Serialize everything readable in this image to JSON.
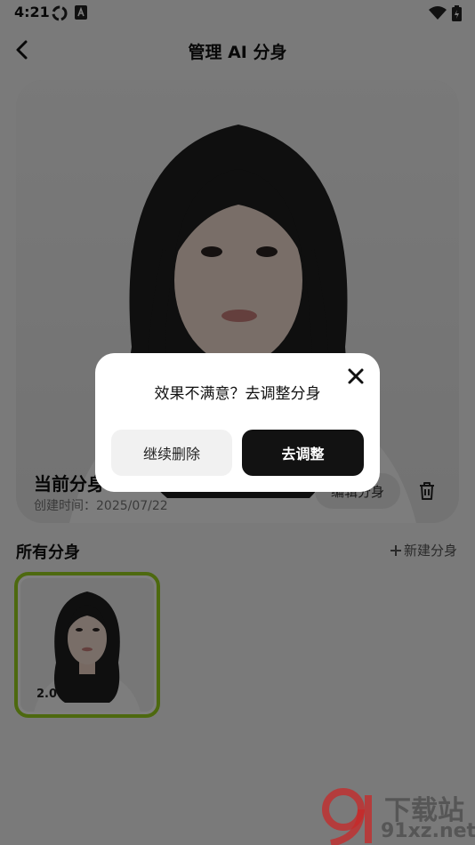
{
  "status": {
    "time": "4:21"
  },
  "appbar": {
    "title": "管理 AI 分身"
  },
  "current": {
    "name": "当前分身",
    "created_label": "创建时间：",
    "created_date": "2025/07/22",
    "rebuild_label": "编辑分身"
  },
  "section": {
    "title": "所有分身",
    "new_label": "新建分身"
  },
  "thumbs": [
    {
      "badge": "2.0",
      "selected": true
    }
  ],
  "dialog": {
    "message": "效果不满意？去调整分身",
    "continue_label": "继续删除",
    "adjust_label": "去调整"
  },
  "watermark": {
    "line1": "下载站",
    "line2": "91xz.net"
  },
  "colors": {
    "accent": "#9bd21e",
    "primary_button": "#121212",
    "overlay": "rgba(0,0,0,0.5)"
  }
}
